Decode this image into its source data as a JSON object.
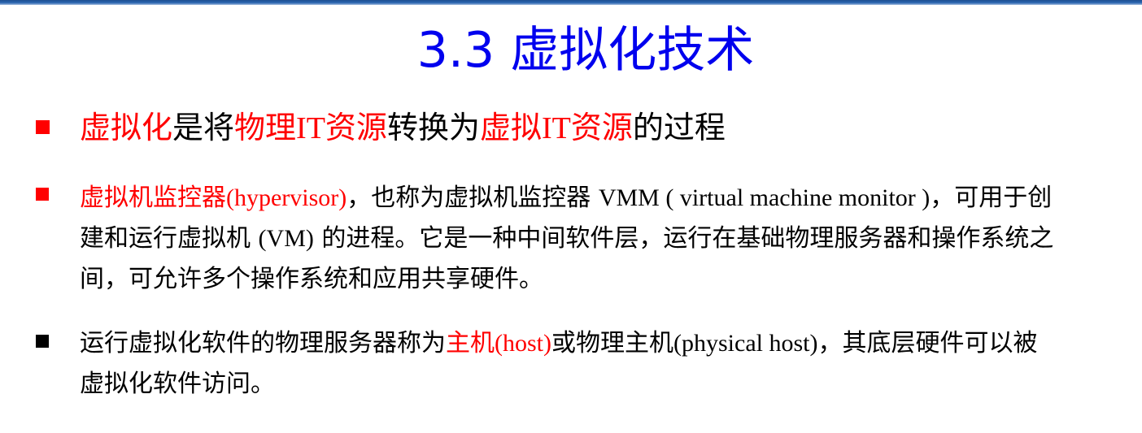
{
  "title": "3.3 虚拟化技术",
  "bullet1": {
    "parts": [
      "虚拟化",
      "是将",
      "物理",
      "IT",
      "资源",
      "转换为",
      "虚拟",
      "IT",
      "资源",
      "的过程"
    ]
  },
  "bullet2": {
    "lines": [
      [
        "虚拟机监控器",
        "(hypervisor)",
        "，也称为虚拟机监控器 ",
        "VMM ( virtual machine monitor )",
        "，可用于创"
      ],
      [
        "建和运行虚拟机 ",
        "(VM)",
        " 的进程。它是一种中间软件层，运行在基础物理服务器和操作系统之"
      ],
      [
        "间，可允许多个操作系统和应用共享硬件。"
      ]
    ]
  },
  "bullet3": {
    "lines": [
      [
        "运行虚拟化软件的物理服务器称为",
        "主机",
        "(host)",
        "或物理主机",
        "(physical host)",
        "，其底层硬件可以被"
      ],
      [
        "虚拟化软件访问。"
      ]
    ]
  },
  "colors": {
    "title": "#0000ee",
    "highlight": "#ff0000",
    "text": "#000000",
    "top_bar": "#2a65b0"
  }
}
